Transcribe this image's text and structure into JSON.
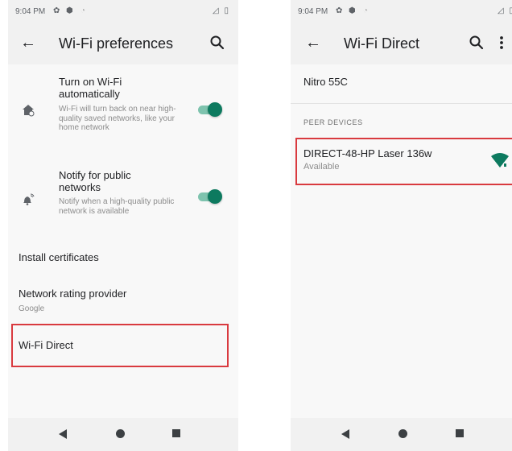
{
  "left_screen": {
    "status": {
      "time": "9:04 PM"
    },
    "title": "Wi-Fi preferences",
    "prefs": [
      {
        "title": "Turn on Wi-Fi automatically",
        "summary": "Wi-Fi will turn back on near high-quality saved networks, like your home network",
        "toggle_on": true
      },
      {
        "title": "Notify for public networks",
        "summary": "Notify when a high-quality public network is available",
        "toggle_on": true
      }
    ],
    "items": [
      {
        "title": "Install certificates"
      },
      {
        "title": "Network rating provider",
        "summary": "Google"
      },
      {
        "title": "Wi-Fi Direct"
      }
    ]
  },
  "right_screen": {
    "status": {
      "time": "9:04 PM"
    },
    "title": "Wi-Fi Direct",
    "device_name": "Nitro 55C",
    "section_header": "PEER DEVICES",
    "peers": [
      {
        "name": "DIRECT-48-HP Laser 136w",
        "status": "Available"
      }
    ]
  },
  "icons": [
    "back-arrow-icon",
    "search-icon",
    "more-vert-icon",
    "wifi-home-icon",
    "wifi-notify-icon",
    "wifi-signal-icon",
    "nav-back-icon",
    "nav-home-icon",
    "nav-recents-icon"
  ],
  "colors": {
    "accent": "#0d7a5f",
    "highlight": "#d93a3f",
    "appbar": "#f1f1f1"
  }
}
